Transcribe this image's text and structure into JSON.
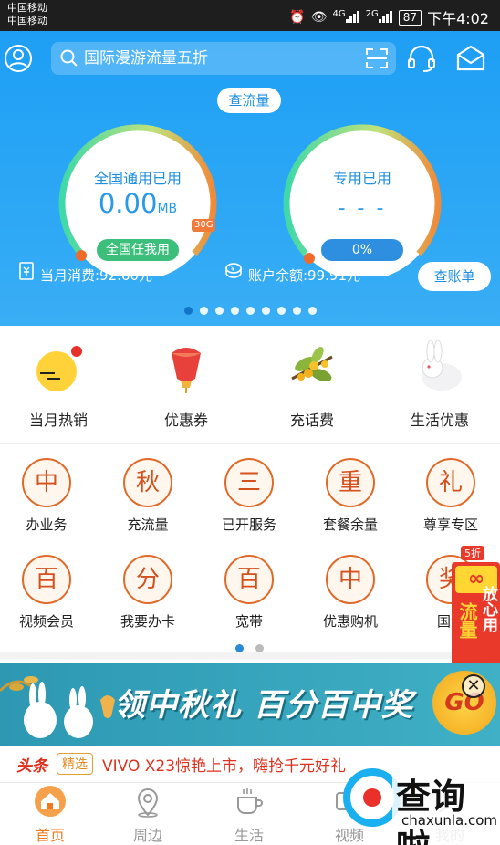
{
  "status_bar": {
    "carrier_1": "中国移动",
    "carrier_2": "中国移动",
    "net_1": "4G",
    "net_2": "2G",
    "battery": "87",
    "time": "下午4:02"
  },
  "header": {
    "search_placeholder": "国际漫游流量五折",
    "check_traffic_label": "查流量",
    "gauges": [
      {
        "title": "全国通用已用",
        "value": "0.00",
        "unit": "MB",
        "pill": "全国任我用",
        "tag": "30G",
        "fill_percent": 0
      },
      {
        "title": "专用已用",
        "value": "- - -",
        "pill": "0%",
        "fill_percent": 0
      }
    ],
    "monthly_spend": "当月消费:92.60元",
    "balance": "账户余额:99.91元",
    "check_bill_label": "查账单",
    "carousel_dots": 9,
    "carousel_active": 1
  },
  "quick_entries": [
    {
      "label": "当月热销",
      "icon": "moon-icon"
    },
    {
      "label": "优惠券",
      "icon": "lantern-icon"
    },
    {
      "label": "充话费",
      "icon": "osmanthus-icon"
    },
    {
      "label": "生活优惠",
      "icon": "rabbit-icon"
    }
  ],
  "services": [
    {
      "char": "中",
      "label": "办业务"
    },
    {
      "char": "秋",
      "label": "充流量"
    },
    {
      "char": "三",
      "label": "已开服务"
    },
    {
      "char": "重",
      "label": "套餐余量"
    },
    {
      "char": "礼",
      "label": "尊享专区"
    },
    {
      "char": "百",
      "label": "视频会员"
    },
    {
      "char": "分",
      "label": "我要办卡"
    },
    {
      "char": "百",
      "label": "宽带"
    },
    {
      "char": "中",
      "label": "优惠购机"
    },
    {
      "char": "奖",
      "label": "国漫"
    }
  ],
  "service_pager": {
    "pages": 2,
    "active": 1
  },
  "promo_float": {
    "discount": "5折",
    "infinity": "∞",
    "line1": "流量",
    "line2": "放心用"
  },
  "banner": {
    "text": "领中秋礼 百分百中奖",
    "go": "GO",
    "close": "✕"
  },
  "news": {
    "source": "头条",
    "tag": "精选",
    "text": "VIVO X23惊艳上市，嗨抢千元好礼"
  },
  "tabs": [
    {
      "label": "首页",
      "icon": "home-icon",
      "active": true
    },
    {
      "label": "周边",
      "icon": "location-icon",
      "active": false
    },
    {
      "label": "生活",
      "icon": "coffee-icon",
      "active": false
    },
    {
      "label": "视频",
      "icon": "video-icon",
      "active": false
    },
    {
      "label": "我的",
      "icon": "user-icon",
      "active": false
    }
  ],
  "watermark": {
    "title": "查询啦",
    "domain": "chaxunla.com"
  },
  "colors": {
    "primary_blue": "#1e9ff5",
    "accent_orange": "#f07a20",
    "service_red": "#d4501c"
  }
}
